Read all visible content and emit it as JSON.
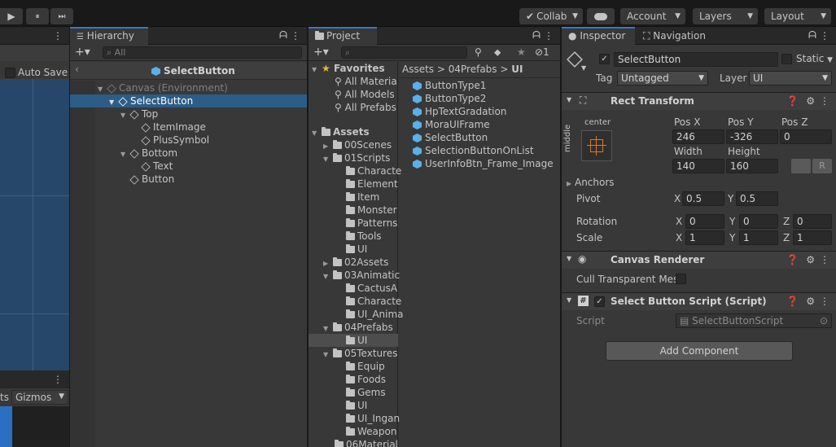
{
  "toolbar": {
    "play_label": "▶",
    "pause_label": "⏸",
    "step_label": "⏭",
    "collab_label": "Collab",
    "account_label": "Account",
    "layers_label": "Layers",
    "layout_label": "Layout"
  },
  "scene": {
    "auto_save_label": "Auto Save",
    "gizmos_label": "Gizmos",
    "ts_label": "ts"
  },
  "hierarchy": {
    "tab_label": "Hierarchy",
    "search_placeholder": "All",
    "prefab_title": "SelectButton",
    "items": [
      {
        "label": "Canvas (Environment)"
      },
      {
        "label": "SelectButton"
      },
      {
        "label": "Top"
      },
      {
        "label": "ItemImage"
      },
      {
        "label": "PlusSymbol"
      },
      {
        "label": "Bottom"
      },
      {
        "label": "Text"
      },
      {
        "label": "Button"
      }
    ]
  },
  "project": {
    "tab_label": "Project",
    "hidden_count": "1",
    "favorites_label": "Favorites",
    "favorites": [
      "All Materia",
      "All Models",
      "All Prefabs"
    ],
    "assets_label": "Assets",
    "tree": [
      "00Scenes",
      "01Scripts",
      "Characte",
      "Element",
      "Item",
      "Monster",
      "Patterns",
      "Tools",
      "UI",
      "02Assets",
      "03Animatic",
      "CactusA",
      "Characte",
      "UI_Anima",
      "04Prefabs",
      "UI",
      "05Textures",
      "Equip",
      "Foods",
      "Gems",
      "UI",
      "UI_Ingan",
      "Weapon",
      "06Material"
    ],
    "breadcrumb": [
      "Assets",
      "04Prefabs",
      "UI"
    ],
    "files": [
      "ButtonType1",
      "ButtonType2",
      "HpTextGradation",
      "MoraUIFrame",
      "SelectButton",
      "SelectionButtonOnList",
      "UserInfoBtn_Frame_Image"
    ]
  },
  "inspector": {
    "tab_label": "Inspector",
    "nav_tab_label": "Navigation",
    "object_name": "SelectButton",
    "static_label": "Static",
    "tag_label": "Tag",
    "tag_value": "Untagged",
    "layer_label": "Layer",
    "layer_value": "UI",
    "rect_transform_title": "Rect Transform",
    "anchor_h": "center",
    "anchor_v": "middle",
    "pos_x_label": "Pos X",
    "pos_x": "246",
    "pos_y_label": "Pos Y",
    "pos_y": "-326",
    "pos_z_label": "Pos Z",
    "pos_z": "0",
    "width_label": "Width",
    "width": "140",
    "height_label": "Height",
    "height": "160",
    "r_label": "R",
    "anchors_label": "Anchors",
    "pivot_label": "Pivot",
    "pivot_x": "0.5",
    "pivot_y": "0.5",
    "rotation_label": "Rotation",
    "rot_x": "0",
    "rot_y": "0",
    "rot_z": "0",
    "scale_label": "Scale",
    "scale_x": "1",
    "scale_y": "1",
    "scale_z": "1",
    "x": "X",
    "y": "Y",
    "z": "Z",
    "canvas_renderer_title": "Canvas Renderer",
    "cull_label": "Cull Transparent Mes",
    "script_comp_title": "Select Button Script (Script)",
    "script_label": "Script",
    "script_value": "SelectButtonScript",
    "add_component_label": "Add Component"
  },
  "colors": {
    "accent": "#3a79bb",
    "selection": "#2c5d87",
    "scene_bg": "#27476a"
  }
}
